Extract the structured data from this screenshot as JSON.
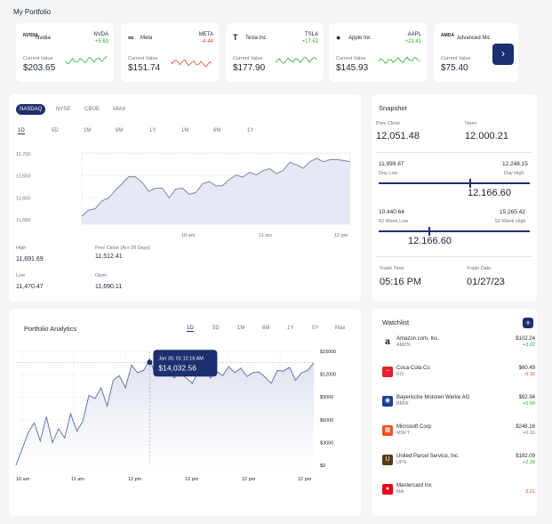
{
  "page_title": "My Portfolio",
  "stocks": [
    {
      "name": "Nvidia",
      "ticker": "NVDA",
      "change": "+5.63",
      "trend": "pos",
      "cv_label": "Current Value",
      "value": "$203.65",
      "logo": "NVIDIA"
    },
    {
      "name": "Meta",
      "ticker": "META",
      "change": "-4.44",
      "trend": "neg",
      "cv_label": "Current Value",
      "value": "$151.74",
      "logo": "∞"
    },
    {
      "name": "Tesla Inc",
      "ticker": "TSLA",
      "change": "+17.63",
      "trend": "pos",
      "cv_label": "Current Value",
      "value": "$177.90",
      "logo": "T"
    },
    {
      "name": "Apple Inc",
      "ticker": "AAPL",
      "change": "+23.41",
      "trend": "pos",
      "cv_label": "Current Value",
      "value": "$145.93",
      "logo": ""
    },
    {
      "name": "Advanced Mic",
      "ticker": "",
      "change": "",
      "trend": "pos",
      "cv_label": "Current Value",
      "value": "$75.40",
      "logo": "AMDA"
    }
  ],
  "exchanges": [
    "NASDAQ",
    "NYSE",
    "CBOE",
    "MIAX"
  ],
  "ranges": [
    "1D",
    "5D",
    "1M",
    "6M",
    "1Y",
    "1M",
    "6M",
    "1Y"
  ],
  "index_chart": {
    "y_ticks": [
      "11,700",
      "11,650",
      "11,600",
      "11,550"
    ],
    "x_ticks": [
      "10 am",
      "11 am",
      "12 pm"
    ]
  },
  "chart_data": [
    {
      "type": "area",
      "x": [
        0,
        1,
        2,
        3,
        4,
        5,
        6,
        7,
        8,
        9,
        10,
        11,
        12,
        13,
        14,
        15,
        16,
        17,
        18,
        19,
        20,
        21,
        22,
        23,
        24,
        25,
        26,
        27,
        28,
        29,
        30,
        31,
        32,
        33,
        34,
        35,
        36,
        37,
        38,
        39,
        40
      ],
      "series": [
        {
          "values": [
            11558,
            11572,
            11575,
            11593,
            11600,
            11617,
            11632,
            11648,
            11648,
            11635,
            11615,
            11622,
            11622,
            11600,
            11620,
            11622,
            11608,
            11612,
            11632,
            11637,
            11627,
            11628,
            11642,
            11652,
            11647,
            11658,
            11652,
            11662,
            11666,
            11655,
            11662,
            11681,
            11675,
            11667,
            11682,
            11690,
            11682,
            11687,
            11687,
            11685,
            11682
          ]
        }
      ],
      "ylim": [
        11540,
        11710
      ],
      "y_ticks": [
        11550,
        11600,
        11650,
        11700
      ],
      "x_ticks": [
        "10 am",
        "11 am",
        "12 pm"
      ]
    },
    {
      "type": "area",
      "title": "Portfolio Analytics",
      "x": [
        0,
        1,
        2,
        3,
        4,
        5,
        6,
        7,
        8,
        9,
        10,
        11,
        12,
        13,
        14,
        15,
        16,
        17,
        18,
        19,
        20,
        21,
        22,
        23,
        24,
        25,
        26,
        27,
        28,
        29,
        30,
        31,
        32,
        33,
        34,
        35,
        36,
        37,
        38,
        39,
        40,
        41,
        42,
        43,
        44,
        45,
        46,
        47,
        48,
        49
      ],
      "series": [
        {
          "values": [
            0,
            2100,
            4300,
            5600,
            3200,
            6400,
            3000,
            4800,
            3600,
            6800,
            4500,
            5800,
            9200,
            8800,
            10200,
            7800,
            11200,
            11800,
            10200,
            13200,
            12200,
            12500,
            14032,
            11800,
            12900,
            12500,
            11500,
            12200,
            11500,
            10800,
            12300,
            12800,
            11500,
            12400,
            11800,
            13000,
            12200,
            12800,
            11700,
            12200,
            12300,
            11600,
            10800,
            12500,
            12400,
            12900,
            11200,
            12200,
            12500,
            13500
          ]
        }
      ],
      "ylim": [
        0,
        15000
      ],
      "y_ticks": [
        "$0",
        "$3000",
        "$6000",
        "$9000",
        "$12000",
        "$15000"
      ],
      "x_ticks": [
        "10 am",
        "11 am",
        "12 pm",
        "12 pm",
        "12 pm",
        "12 pm"
      ]
    }
  ],
  "stats": {
    "high_label": "High",
    "high": "11,691.69",
    "prev_label": "Prev Close (Avr 28 Days)",
    "prev": "11,512.41",
    "low_label": "Low",
    "low": "11,470.47",
    "open_label": "Open",
    "open": "11,690.11"
  },
  "snapshot": {
    "title": "Snapshot",
    "prev_close_label": "Prev Close",
    "prev_close": "12,051.48",
    "open_label": "Open",
    "open": "12.000.21",
    "day_low": "11,999.87",
    "day_low_label": "Day Low",
    "day_high": "12,248.15",
    "day_high_label": "Day High",
    "day_current": "12.166.60",
    "day_position": 0.6,
    "wk_low": "10,440.64",
    "wk_low_label": "52 Week Low",
    "wk_high": "15,265.42",
    "wk_high_label": "52 Week High",
    "wk_current": "12.166.60",
    "wk_position": 0.33,
    "trade_time_label": "Trade Time",
    "trade_time": "05:16 PM",
    "trade_date_label": "Trade Date",
    "trade_date": "01/27/23"
  },
  "analytics": {
    "title": "Portfolio Analytics",
    "ranges": [
      "1D",
      "5D",
      "1M",
      "6M",
      "1Y",
      "5Y",
      "Max"
    ],
    "tooltip_date": "Jan 30, 01:12:16 AM",
    "tooltip_value": "$14,032.56"
  },
  "watchlist": {
    "title": "Watchlist",
    "add": "+",
    "items": [
      {
        "name": "Amazon.com, Inc.",
        "ticker": "AMZN",
        "price": "$102.24",
        "change": "+3.02",
        "trend": "pos",
        "color": "#ffffff",
        "icon": "a"
      },
      {
        "name": "Coca-Cola Co",
        "ticker": "KO",
        "price": "$60.49",
        "change": "-0.32",
        "trend": "neg",
        "color": "#e3202c",
        "icon": "~"
      },
      {
        "name": "Bayerische Motoren Werke AG",
        "ticker": "BMW",
        "price": "$92.94",
        "change": "+0.59",
        "trend": "pos",
        "color": "#1c3f94",
        "icon": "◉"
      },
      {
        "name": "Microsoft Corp",
        "ticker": "MSFT",
        "price": "$248.16",
        "change": "+0.16",
        "trend": "pos",
        "color": "#f25022",
        "icon": "▦"
      },
      {
        "name": "United Parcel Service, Inc.",
        "ticker": "UPS",
        "price": "$182.09",
        "change": "+2.39",
        "trend": "pos",
        "color": "#5a3a18",
        "icon": "U"
      },
      {
        "name": "Mastercard Inc",
        "ticker": "MA",
        "price": "",
        "change": "-3.21",
        "trend": "neg",
        "color": "#eb001b",
        "icon": "●"
      }
    ]
  }
}
